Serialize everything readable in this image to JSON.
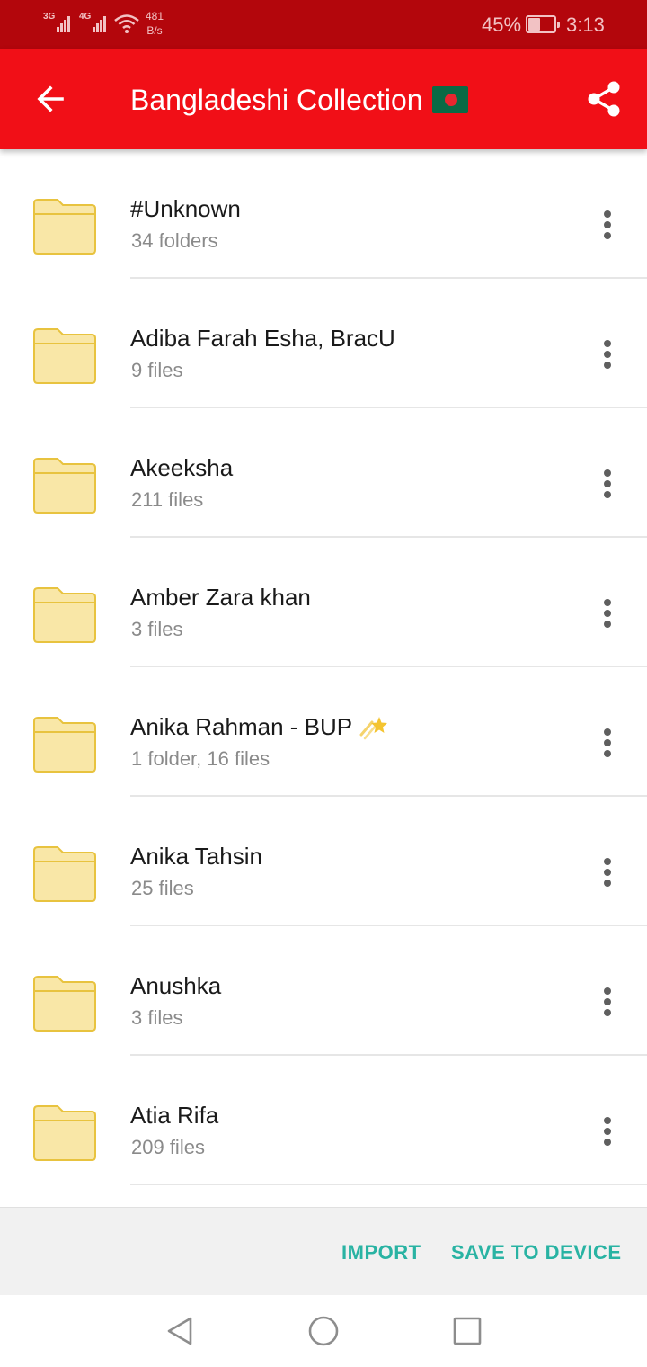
{
  "status_bar": {
    "network1": "3G",
    "network2": "4G",
    "speed_value": "481",
    "speed_unit": "B/s",
    "battery_percent": "45%",
    "battery_level": 0.45,
    "time": "3:13"
  },
  "toolbar": {
    "title": "Bangladeshi Collection",
    "back_icon": "arrow-back-icon",
    "share_icon": "share-icon",
    "flag_icon": "bangladesh-flag-icon"
  },
  "folders": [
    {
      "name": "#Unknown",
      "meta": "34 folders"
    },
    {
      "name": "Adiba Farah Esha, BracU",
      "meta": "9 files"
    },
    {
      "name": "Akeeksha",
      "meta": "211 files"
    },
    {
      "name": "Amber Zara khan",
      "meta": "3 files"
    },
    {
      "name": "Anika Rahman - BUP",
      "meta": "1 folder, 16 files",
      "emoji": "shooting-star-icon"
    },
    {
      "name": "Anika Tahsin",
      "meta": "25 files"
    },
    {
      "name": "Anushka",
      "meta": "3 files"
    },
    {
      "name": "Atia Rifa",
      "meta": "209 files"
    }
  ],
  "actions": {
    "import_label": "IMPORT",
    "save_label": "SAVE TO DEVICE"
  },
  "colors": {
    "status_bar": "#b3060c",
    "toolbar": "#f10f17",
    "folder_fill": "#f9e7a7",
    "folder_stroke": "#e8c33f",
    "action_text": "#29b3a3"
  }
}
